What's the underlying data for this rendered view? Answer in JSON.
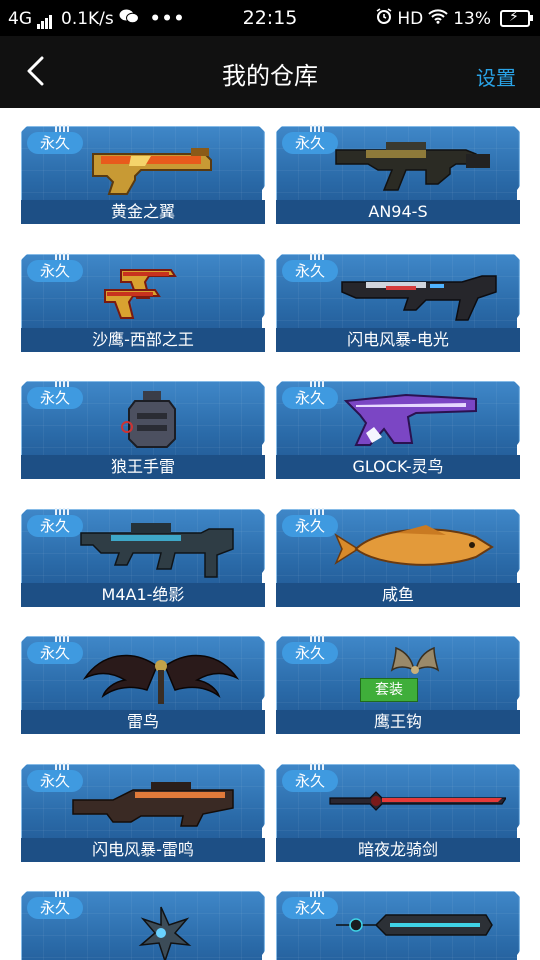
{
  "status_bar": {
    "network": "4G",
    "speed": "0.1K/s",
    "dots": "•••",
    "time": "22:15",
    "hd": "HD",
    "battery": "13%"
  },
  "nav": {
    "title": "我的仓库",
    "settings": "设置"
  },
  "items": [
    {
      "badge": "永久",
      "name": "黄金之翼",
      "icon": "golden-pistol-icon"
    },
    {
      "badge": "永久",
      "name": "AN94-S",
      "icon": "assault-rifle-icon"
    },
    {
      "badge": "永久",
      "name": "沙鹰-西部之王",
      "icon": "dual-pistols-icon"
    },
    {
      "badge": "永久",
      "name": "闪电风暴-电光",
      "icon": "futuristic-rifle-icon"
    },
    {
      "badge": "永久",
      "name": "狼王手雷",
      "icon": "grenade-icon"
    },
    {
      "badge": "永久",
      "name": "GLOCK-灵鸟",
      "icon": "purple-pistol-icon"
    },
    {
      "badge": "永久",
      "name": "M4A1-绝影",
      "icon": "m4a1-rifle-icon"
    },
    {
      "badge": "永久",
      "name": "咸鱼",
      "icon": "salted-fish-icon"
    },
    {
      "badge": "永久",
      "name": "雷鸟",
      "icon": "thunderbird-wings-icon"
    },
    {
      "badge": "永久",
      "name": "鹰王钩",
      "icon": "eagle-claw-icon",
      "tag": "套装"
    },
    {
      "badge": "永久",
      "name": "闪电风暴-雷鸣",
      "icon": "sniper-rifle-icon"
    },
    {
      "badge": "永久",
      "name": "暗夜龙骑剑",
      "icon": "red-sword-icon"
    },
    {
      "badge": "永久",
      "name": "",
      "icon": "shuriken-icon"
    },
    {
      "badge": "永久",
      "name": "",
      "icon": "chainsaw-blade-icon"
    }
  ]
}
